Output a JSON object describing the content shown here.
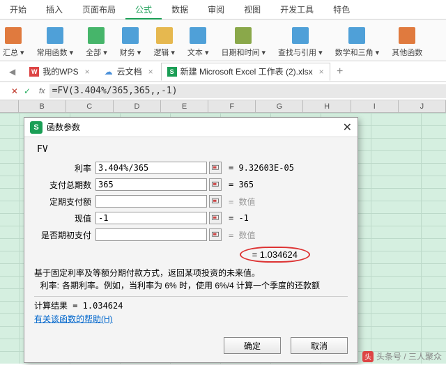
{
  "ribbon": {
    "tabs": [
      "开始",
      "插入",
      "页面布局",
      "公式",
      "数据",
      "审阅",
      "视图",
      "开发工具",
      "特色"
    ],
    "active_index": 3,
    "groups": [
      {
        "label": "汇总 ▾",
        "color": "#e07a3e"
      },
      {
        "label": "常用函数 ▾",
        "color": "#4fa0d8"
      },
      {
        "label": "全部 ▾",
        "color": "#46b56a"
      },
      {
        "label": "财务 ▾",
        "color": "#4fa0d8"
      },
      {
        "label": "逻辑 ▾",
        "color": "#e6b84f"
      },
      {
        "label": "文本 ▾",
        "color": "#4fa0d8"
      },
      {
        "label": "日期和时间 ▾",
        "color": "#8aa84a"
      },
      {
        "label": "查找与引用 ▾",
        "color": "#4fa0d8"
      },
      {
        "label": "数学和三角 ▾",
        "color": "#4fa0d8"
      },
      {
        "label": "其他函数",
        "color": "#e07a3e"
      }
    ]
  },
  "doctabs": {
    "wps_label": "我的WPS",
    "cloud_label": "云文档",
    "file_label": "新建 Microsoft Excel 工作表 (2).xlsx"
  },
  "formula_bar": {
    "formula": "=FV(3.404%/365,365,,-1)"
  },
  "columns": [
    "B",
    "C",
    "D",
    "E",
    "F",
    "G",
    "H",
    "I",
    "J"
  ],
  "dialog": {
    "title": "函数参数",
    "fn": "FV",
    "args": [
      {
        "label": "利率",
        "input": "3.404%/365",
        "value": "= 9.32603E-05",
        "grey": false
      },
      {
        "label": "支付总期数",
        "input": "365",
        "value": "= 365",
        "grey": false
      },
      {
        "label": "定期支付额",
        "input": "",
        "value": "= 数值",
        "grey": true
      },
      {
        "label": "现值",
        "input": "-1",
        "value": "= -1",
        "grey": false
      },
      {
        "label": "是否期初支付",
        "input": "",
        "value": "= 数值",
        "grey": true
      }
    ],
    "result_preview": "= 1.034624",
    "desc_main": "基于固定利率及等额分期付款方式，返回某项投资的未来值。",
    "desc_key": "利率:",
    "desc_val": "各期利率。例如，当利率为 6% 时，使用 6%/4 计算一个季度的还款额",
    "calc_result": "计算结果 = 1.034624",
    "help_link": "有关该函数的帮助(H)",
    "ok": "确定",
    "cancel": "取消"
  },
  "cell_formula": "=FV(3.404%/365,365,,-1)",
  "watermark": "头条号 / 三人聚众"
}
